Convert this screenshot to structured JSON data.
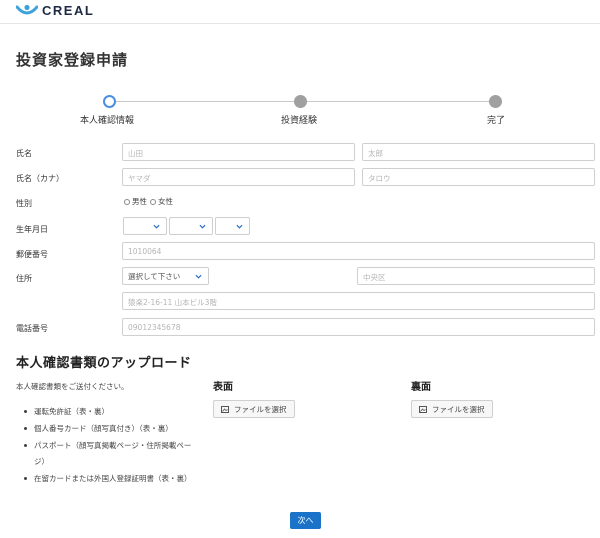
{
  "brand": {
    "logo_text": "CREAL",
    "logo_color": "#3ea3dc"
  },
  "page_title": "投資家登録申請",
  "steps": [
    {
      "label": "本人確認情報",
      "state": "active"
    },
    {
      "label": "投資経験",
      "state": "todo"
    },
    {
      "label": "完了",
      "state": "todo"
    }
  ],
  "form": {
    "name": {
      "label": "氏名",
      "last_placeholder": "山田",
      "first_placeholder": "太郎"
    },
    "kana": {
      "label": "氏名（カナ）",
      "last_placeholder": "ヤマダ",
      "first_placeholder": "タロウ"
    },
    "gender": {
      "label": "性別",
      "options": [
        "男性",
        "女性"
      ]
    },
    "birthdate": {
      "label": "生年月日"
    },
    "postal": {
      "label": "郵便番号",
      "placeholder": "1010064"
    },
    "address": {
      "label": "住所",
      "prefecture_select": "選択して下さい",
      "city_placeholder": "中央区",
      "street_placeholder": "猿楽2-16-11 山本ビル3階"
    },
    "phone": {
      "label": "電話番号",
      "placeholder": "09012345678"
    }
  },
  "upload": {
    "title": "本人確認書類のアップロード",
    "note": "本人確認書類をご送付ください。",
    "documents": [
      "運転免許証（表・裏）",
      "個人番号カード（顔写真付き）（表・裏）",
      "パスポート（顔写真掲載ページ・住所掲載ページ）",
      "在留カードまたは外国人登録証明書（表・裏）"
    ],
    "front": {
      "title": "表面",
      "button": "ファイルを選択"
    },
    "back": {
      "title": "裏面",
      "button": "ファイルを選択"
    }
  },
  "next_button": "次へ",
  "colors": {
    "accent": "#1a73c8",
    "step_active": "#4a90e2",
    "step_todo": "#a0a0a0"
  }
}
